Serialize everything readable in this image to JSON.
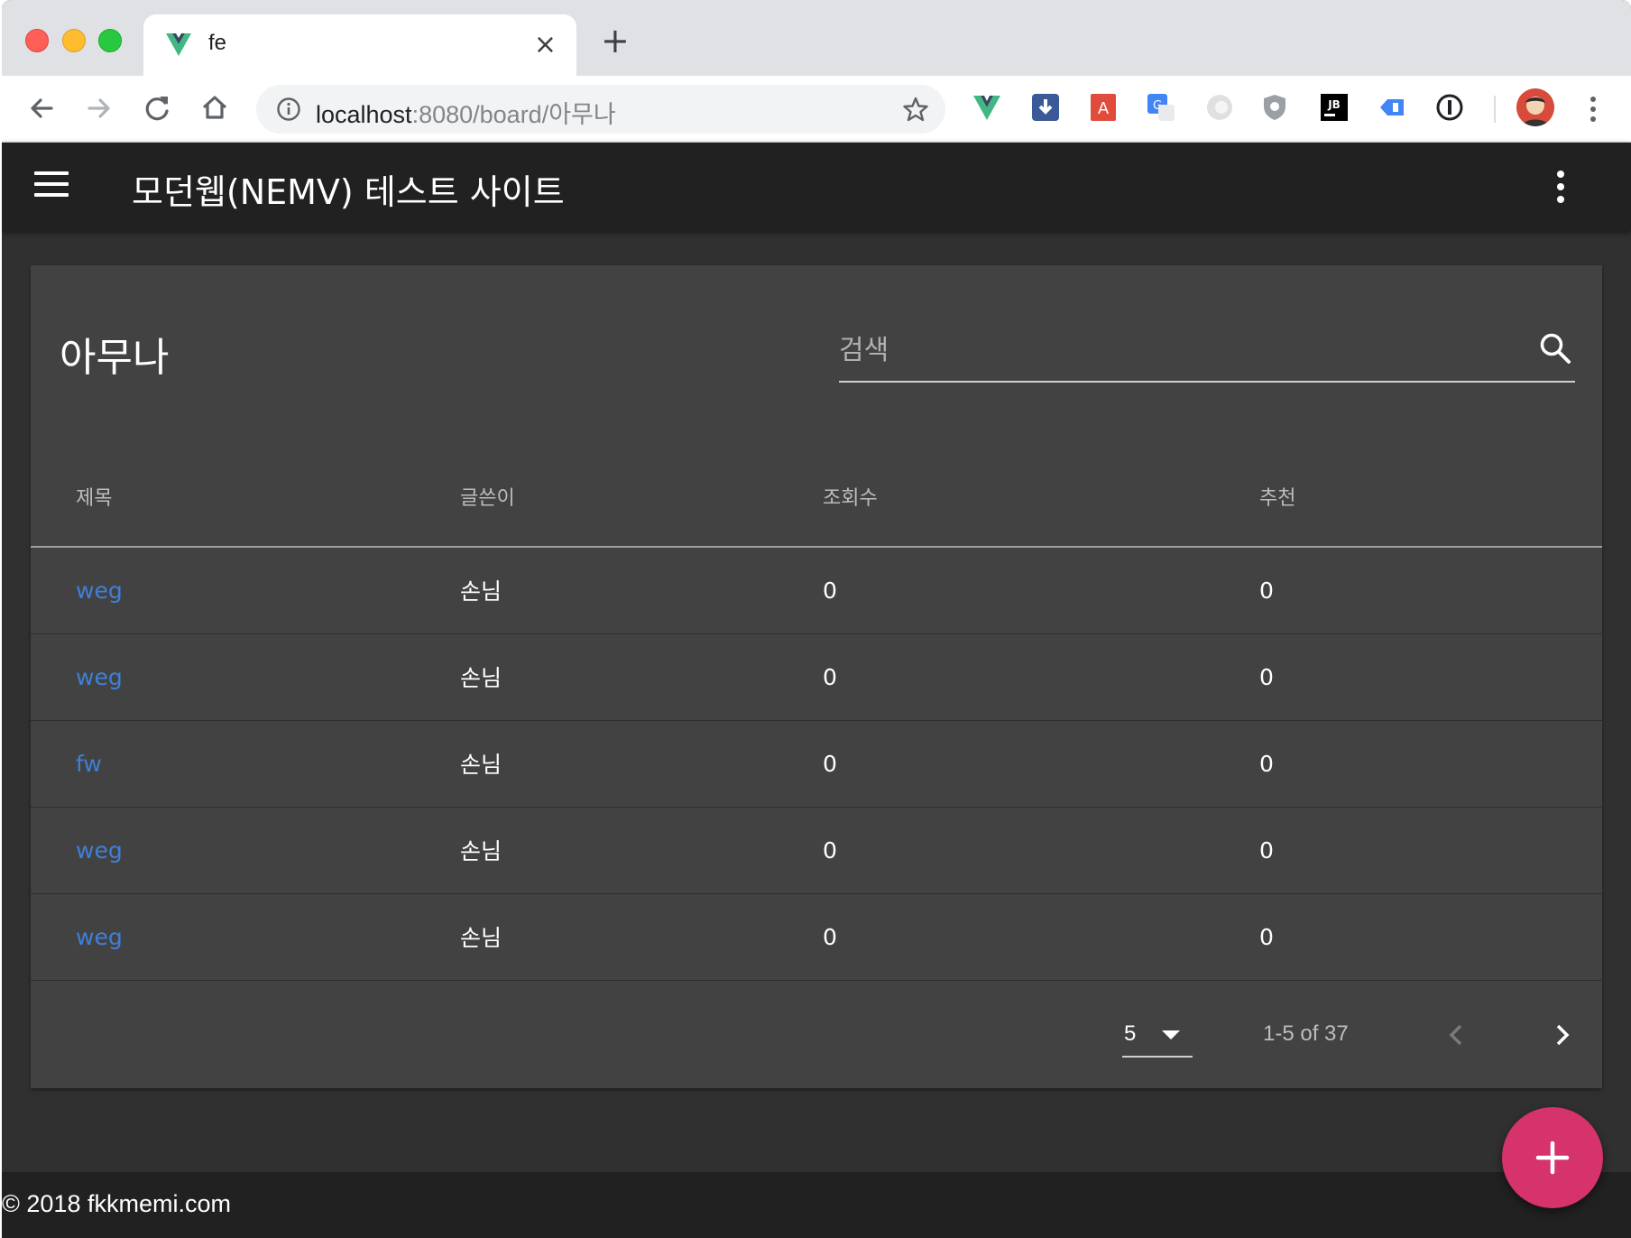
{
  "browser": {
    "tab_title": "fe",
    "new_tab_symbol": "+",
    "close_tab_symbol": "×",
    "url_host": "localhost",
    "url_rest": ":8080/board/아무나"
  },
  "icons": {
    "back": "back-arrow-icon",
    "forward": "forward-arrow-icon",
    "reload": "reload-icon",
    "home": "home-icon",
    "info": "info-icon",
    "star": "star-icon",
    "extensions": [
      "vue-devtools-icon",
      "download-icon",
      "acrobat-icon",
      "google-translate-icon",
      "extension-circle-icon",
      "shield-icon",
      "jetbrains-icon",
      "tag-icon",
      "password-manager-icon"
    ]
  },
  "appbar": {
    "title": "모던웹(NEMV) 테스트 사이트"
  },
  "board": {
    "title": "아무나",
    "search_placeholder": "검색",
    "columns": [
      "제목",
      "글쓴이",
      "조회수",
      "추천"
    ],
    "rows": [
      {
        "title": "weg",
        "author": "손님",
        "views": "0",
        "likes": "0"
      },
      {
        "title": "weg",
        "author": "손님",
        "views": "0",
        "likes": "0"
      },
      {
        "title": "fw",
        "author": "손님",
        "views": "0",
        "likes": "0"
      },
      {
        "title": "weg",
        "author": "손님",
        "views": "0",
        "likes": "0"
      },
      {
        "title": "weg",
        "author": "손님",
        "views": "0",
        "likes": "0"
      }
    ],
    "rows_per_page": "5",
    "page_info": "1-5 of 37"
  },
  "footer": {
    "copyright": "© 2018 fkkmemi.com"
  },
  "colors": {
    "appbar": "#212121",
    "background": "#303030",
    "card": "#424242",
    "link": "#3f7fd8",
    "fab": "#d6336c"
  }
}
